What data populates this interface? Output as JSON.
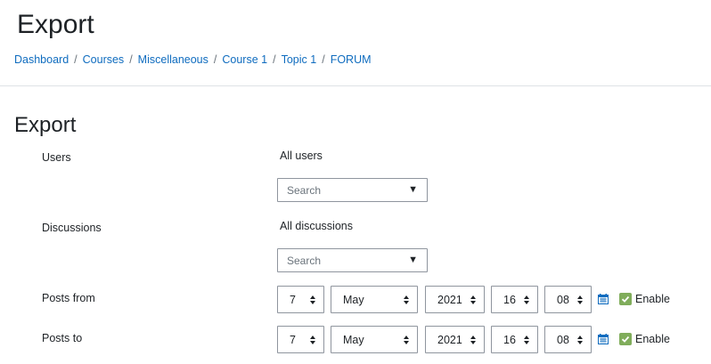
{
  "header": {
    "title": "Export"
  },
  "breadcrumb": [
    "Dashboard",
    "Courses",
    "Miscellaneous",
    "Course 1",
    "Topic 1",
    "FORUM"
  ],
  "breadcrumb_separator": "/",
  "form": {
    "title": "Export",
    "users": {
      "label": "Users",
      "selected": "All users",
      "placeholder": "Search",
      "caret": "▼"
    },
    "discussions": {
      "label": "Discussions",
      "selected": "All discussions",
      "placeholder": "Search",
      "caret": "▼"
    },
    "posts_from": {
      "label": "Posts from",
      "day": "7",
      "month": "May",
      "year": "2021",
      "hour": "16",
      "minute": "08",
      "enable_label": "Enable",
      "enabled": true
    },
    "posts_to": {
      "label": "Posts to",
      "day": "7",
      "month": "May",
      "year": "2021",
      "hour": "16",
      "minute": "08",
      "enable_label": "Enable",
      "enabled": true
    }
  },
  "colors": {
    "link": "#0f6cbf",
    "checkbox": "#80ad5b",
    "calendar_icon": "#0f6cbf"
  }
}
